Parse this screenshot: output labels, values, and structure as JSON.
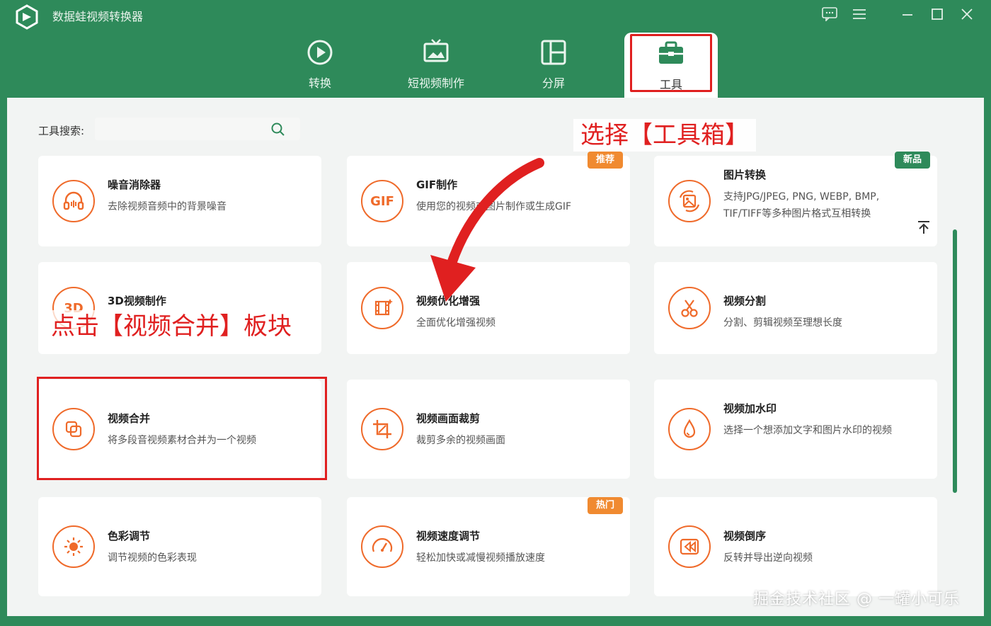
{
  "app": {
    "title": "数据蛙视频转换器"
  },
  "tabs": [
    {
      "label": "转换"
    },
    {
      "label": "短视频制作"
    },
    {
      "label": "分屏"
    },
    {
      "label": "工具"
    }
  ],
  "search": {
    "label": "工具搜索:",
    "placeholder": ""
  },
  "tools": [
    {
      "title": "噪音消除器",
      "desc": "去除视频音频中的背景噪音",
      "icon": "headphones-icon",
      "badge": ""
    },
    {
      "title": "GIF制作",
      "desc": "使用您的视频或图片制作或生成GIF",
      "icon": "gif-icon",
      "badge": "推荐"
    },
    {
      "title": "图片转换",
      "desc": "支持JPG/JPEG, PNG, WEBP, BMP, TIF/TIFF等多种图片格式互相转换",
      "icon": "image-convert-icon",
      "badge": "新品"
    },
    {
      "title": "3D视频制作",
      "desc": "",
      "icon": "3d-icon",
      "badge": ""
    },
    {
      "title": "视频优化增强",
      "desc": "全面优化增强视频",
      "icon": "film-enhance-icon",
      "badge": ""
    },
    {
      "title": "视频分割",
      "desc": "分割、剪辑视频至理想长度",
      "icon": "scissors-icon",
      "badge": ""
    },
    {
      "title": "视频合并",
      "desc": "将多段音视频素材合并为一个视频",
      "icon": "merge-icon",
      "badge": ""
    },
    {
      "title": "视频画面裁剪",
      "desc": "裁剪多余的视频画面",
      "icon": "crop-icon",
      "badge": ""
    },
    {
      "title": "视频加水印",
      "desc": "选择一个想添加文字和图片水印的视频",
      "icon": "watermark-drop-icon",
      "badge": ""
    },
    {
      "title": "色彩调节",
      "desc": "调节视频的色彩表现",
      "icon": "sun-color-icon",
      "badge": ""
    },
    {
      "title": "视频速度调节",
      "desc": "轻松加快或减慢视频播放速度",
      "icon": "speedometer-icon",
      "badge": "热门"
    },
    {
      "title": "视频倒序",
      "desc": "反转并导出逆向视频",
      "icon": "rewind-icon",
      "badge": ""
    }
  ],
  "annotations": {
    "select_toolbox": "选择【工具箱】",
    "click_merge": "点击【视频合并】板块"
  },
  "watermark": "掘金技术社区 @ 一罐小可乐",
  "colors": {
    "primary_green": "#2e8a5a",
    "accent_orange": "#ef6a2a",
    "annotation_red": "#e02020"
  }
}
